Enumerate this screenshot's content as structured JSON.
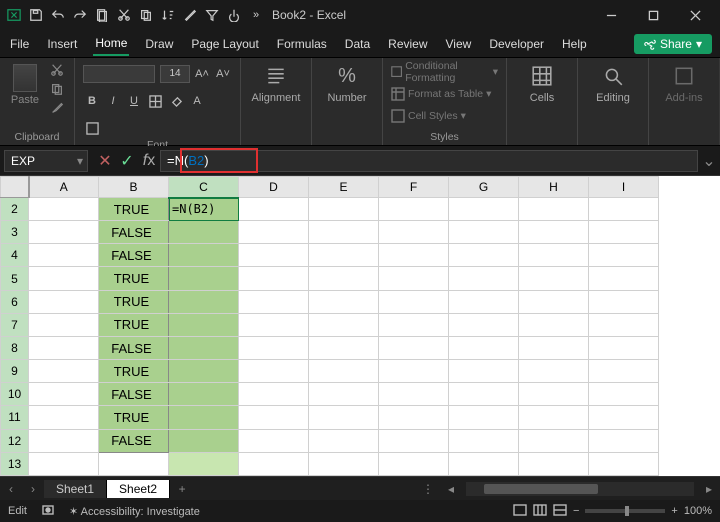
{
  "app": {
    "title": "Book2 - Excel",
    "search_icon": "search"
  },
  "qat_icons": [
    "excel",
    "save",
    "undo",
    "redo",
    "new",
    "cut",
    "copy",
    "paste",
    "format-painter",
    "sort",
    "filter",
    "touch",
    "print",
    "preview",
    "ellipsis"
  ],
  "tabs": [
    "File",
    "Insert",
    "Home",
    "Draw",
    "Page Layout",
    "Formulas",
    "Data",
    "Review",
    "View",
    "Developer",
    "Help"
  ],
  "active_tab": "Home",
  "share_label": "Share",
  "ribbon": {
    "clipboard_label": "Clipboard",
    "paste_label": "Paste",
    "font_label": "Font",
    "font_size": "14",
    "alignment_label": "Alignment",
    "number_label": "Number",
    "styles_label": "Styles",
    "cond_fmt": "Conditional Formatting",
    "fmt_table": "Format as Table",
    "cell_styles": "Cell Styles",
    "cells_label": "Cells",
    "editing_label": "Editing",
    "addins_label": "Add-ins"
  },
  "namebox": "EXP",
  "formula_prefix": "=N(",
  "formula_ref": "B2",
  "formula_suffix": ")",
  "columns": [
    "A",
    "B",
    "C",
    "D",
    "E",
    "F",
    "G",
    "H",
    "I"
  ],
  "rows": [
    {
      "n": 2,
      "b": "TRUE",
      "c": "=N(B2)"
    },
    {
      "n": 3,
      "b": "FALSE",
      "c": ""
    },
    {
      "n": 4,
      "b": "FALSE",
      "c": ""
    },
    {
      "n": 5,
      "b": "TRUE",
      "c": ""
    },
    {
      "n": 6,
      "b": "TRUE",
      "c": ""
    },
    {
      "n": 7,
      "b": "TRUE",
      "c": ""
    },
    {
      "n": 8,
      "b": "FALSE",
      "c": ""
    },
    {
      "n": 9,
      "b": "TRUE",
      "c": ""
    },
    {
      "n": 10,
      "b": "FALSE",
      "c": ""
    },
    {
      "n": 11,
      "b": "TRUE",
      "c": ""
    },
    {
      "n": 12,
      "b": "FALSE",
      "c": ""
    },
    {
      "n": 13,
      "b": "",
      "c": "",
      "noGreenB": true,
      "lightC": true
    }
  ],
  "sheets": [
    "Sheet1",
    "Sheet2"
  ],
  "active_sheet": "Sheet2",
  "status": {
    "mode": "Edit",
    "accessibility": "Accessibility: Investigate",
    "zoom": "100%"
  }
}
